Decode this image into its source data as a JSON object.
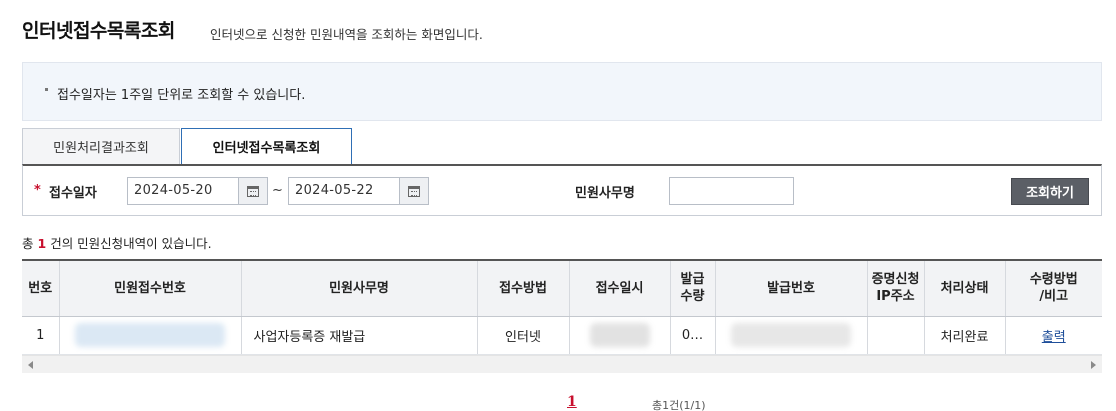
{
  "header": {
    "title": "인터넷접수목록조회",
    "description": "인터넷으로 신청한 민원내역을 조회하는 화면입니다."
  },
  "notice": {
    "text": "접수일자는 1주일 단위로 조회할 수 있습니다."
  },
  "tabs": [
    {
      "label": "민원처리결과조회",
      "active": false
    },
    {
      "label": "인터넷접수목록조회",
      "active": true
    }
  ],
  "search": {
    "required_mark": "*",
    "date_label": "접수일자",
    "date_from": "2024-05-20",
    "date_to": "2024-05-22",
    "range_separator": "~",
    "office_label": "민원사무명",
    "office_value": "",
    "submit_label": "조회하기"
  },
  "result_count": {
    "prefix": "총",
    "count": "1",
    "suffix": "건의 민원신청내역이 있습니다."
  },
  "table": {
    "columns": [
      "번호",
      "민원접수번호",
      "민원사무명",
      "접수방법",
      "접수일시",
      "발급\n수량",
      "발급번호",
      "증명신청\nIP주소",
      "처리상태",
      "수령방법\n/비고"
    ],
    "rows": [
      {
        "no": "1",
        "receipt_no": "",
        "office_name": "사업자등록증 재발급",
        "method": "인터넷",
        "received_at": "",
        "issue_qty": "0…",
        "issue_no": "",
        "ip": "",
        "status": "처리완료",
        "pickup": "출력"
      }
    ]
  },
  "pager": {
    "current": "1",
    "total": "총1건(1/1)"
  },
  "colors": {
    "accent_red": "#c8102e",
    "active_tab_border": "#2f6fb5",
    "button_bg": "#5b5f66",
    "link": "#1f4f9a"
  }
}
